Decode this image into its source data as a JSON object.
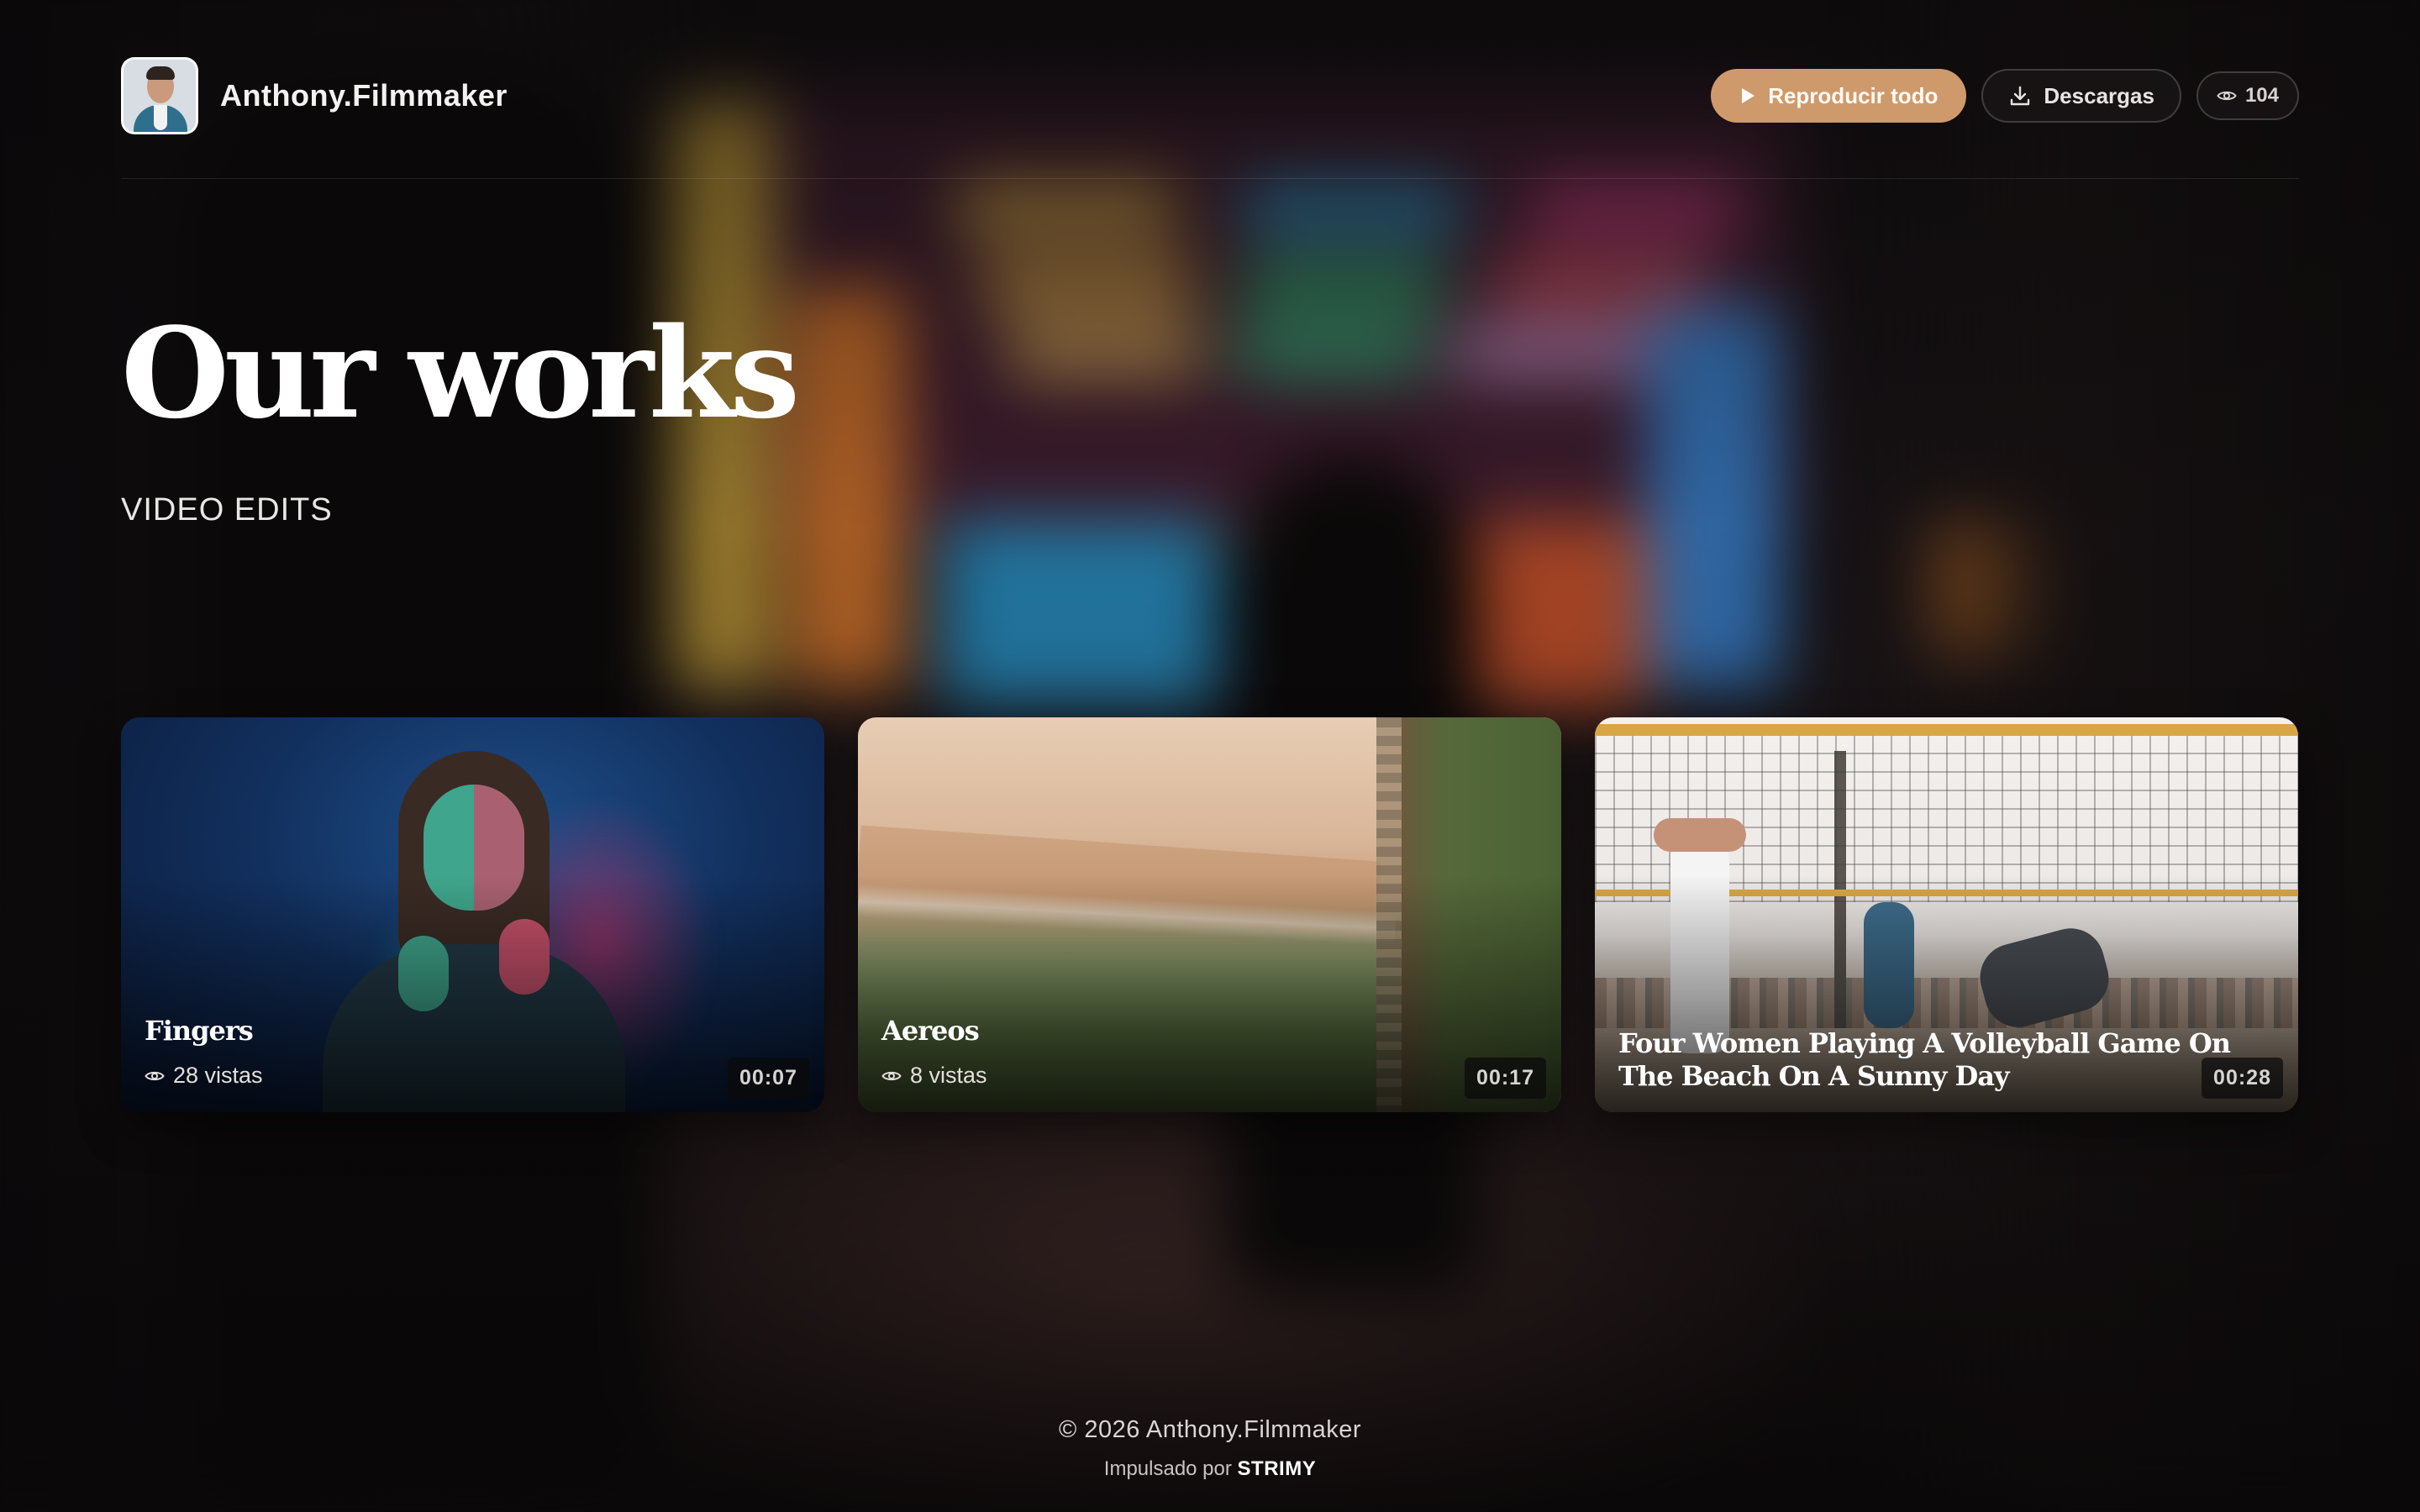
{
  "header": {
    "channel_name": "Anthony.Filmmaker",
    "play_all_label": "Reproducir todo",
    "downloads_label": "Descargas",
    "view_count": "104"
  },
  "hero": {
    "title": "Our works",
    "subtitle": "VIDEO EDITS"
  },
  "videos": [
    {
      "title": "Fingers",
      "views": "28 vistas",
      "duration": "00:07"
    },
    {
      "title": "Aereos",
      "views": "8 vistas",
      "duration": "00:17"
    },
    {
      "title": "Four Women Playing A Volleyball Game On The Beach On A Sunny Day",
      "duration": "00:28"
    }
  ],
  "footer": {
    "copyright": "© 2026 Anthony.Filmmaker",
    "powered_prefix": "Impulsado por",
    "powered_brand": "STRIMY"
  },
  "colors": {
    "accent": "#cf9a6b",
    "background": "#0d0b0d"
  },
  "icons": {
    "play": "play-icon",
    "download": "download-icon",
    "views": "eye-icon"
  }
}
